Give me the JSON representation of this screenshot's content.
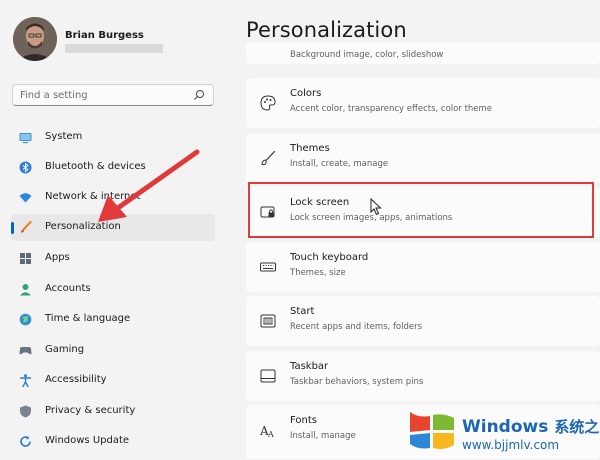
{
  "user": {
    "name": "Brian Burgess"
  },
  "search": {
    "placeholder": "Find a setting"
  },
  "sidebar": {
    "items": [
      {
        "label": "System",
        "icon": "monitor-icon"
      },
      {
        "label": "Bluetooth & devices",
        "icon": "bluetooth-icon"
      },
      {
        "label": "Network & internet",
        "icon": "wifi-icon"
      },
      {
        "label": "Personalization",
        "icon": "brush-icon",
        "active": true
      },
      {
        "label": "Apps",
        "icon": "apps-icon"
      },
      {
        "label": "Accounts",
        "icon": "person-icon"
      },
      {
        "label": "Time & language",
        "icon": "globe-icon"
      },
      {
        "label": "Gaming",
        "icon": "gamepad-icon"
      },
      {
        "label": "Accessibility",
        "icon": "accessibility-icon"
      },
      {
        "label": "Privacy & security",
        "icon": "shield-icon"
      },
      {
        "label": "Windows Update",
        "icon": "update-icon"
      }
    ]
  },
  "main": {
    "title": "Personalization",
    "partial_subtitle": "Background image, color, slideshow",
    "cards": [
      {
        "title": "Colors",
        "subtitle": "Accent color, transparency effects, color theme",
        "icon": "palette-icon"
      },
      {
        "title": "Themes",
        "subtitle": "Install, create, manage",
        "icon": "brush-icon"
      },
      {
        "title": "Lock screen",
        "subtitle": "Lock screen images, apps, animations",
        "icon": "lock-screen-icon"
      },
      {
        "title": "Touch keyboard",
        "subtitle": "Themes, size",
        "icon": "keyboard-icon"
      },
      {
        "title": "Start",
        "subtitle": "Recent apps and items, folders",
        "icon": "start-icon"
      },
      {
        "title": "Taskbar",
        "subtitle": "Taskbar behaviors, system pins",
        "icon": "taskbar-icon"
      },
      {
        "title": "Fonts",
        "subtitle": "Install, manage",
        "icon": "fonts-icon"
      }
    ]
  },
  "watermark": {
    "brand": "Windows",
    "cn": "系统之家",
    "url": "www.bjjmlv.com"
  },
  "colors": {
    "accent": "#0067c0",
    "highlight": "#e03a3a",
    "watermark": "#1b66b3"
  }
}
